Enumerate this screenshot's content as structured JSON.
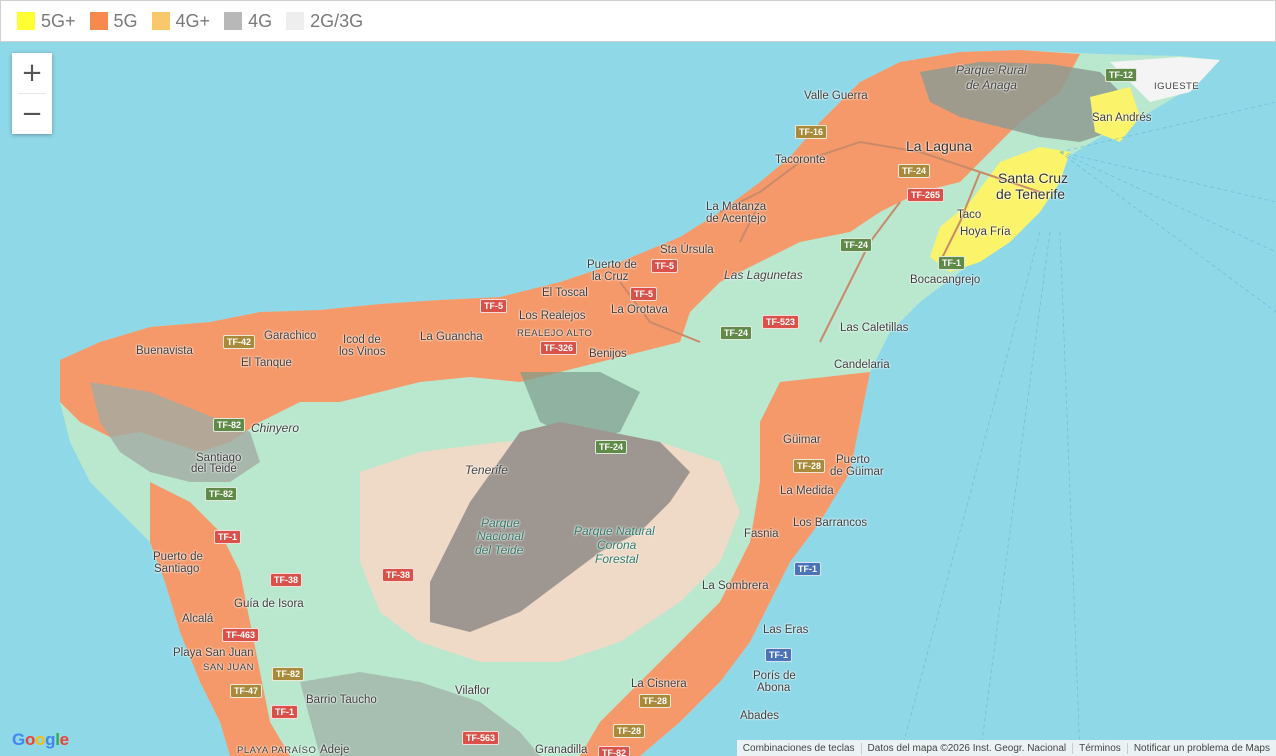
{
  "legend": {
    "items": [
      {
        "label": "5G+",
        "color": "#ffff33"
      },
      {
        "label": "5G",
        "color": "#f58a4e"
      },
      {
        "label": "4G+",
        "color": "#f8c86a"
      },
      {
        "label": "4G",
        "color": "#b8b8b8"
      },
      {
        "label": "2G/3G",
        "color": "#eeeeee"
      }
    ]
  },
  "zoom": {
    "in": "+",
    "out": "−"
  },
  "places": {
    "parque_rural": "Parque Rural",
    "anaga": "de Anaga",
    "igueste": "IGUESTE",
    "valle_guerra": "Valle Guerra",
    "san_andres": "San Andrés",
    "la_laguna": "La Laguna",
    "tacoronte": "Tacoronte",
    "santa_cruz_1": "Santa Cruz",
    "santa_cruz_2": "de Tenerife",
    "la_matanza_1": "La Matanza",
    "la_matanza_2": "de Acentejo",
    "taco": "Taco",
    "hoya_fria": "Hoya Fría",
    "sta_ursula": "Sta Úrsula",
    "puerto_cruz_1": "Puerto de",
    "puerto_cruz_2": "la Cruz",
    "las_lagunetas": "Las Lagunetas",
    "bocacangrejo": "Bocacangrejo",
    "el_toscal": "El Toscal",
    "los_realejos": "Los Realejos",
    "la_orotava": "La Orotava",
    "realejo_alto": "REALEJO ALTO",
    "garachico": "Garachico",
    "icod_1": "Icod de",
    "icod_2": "los Vinos",
    "la_guancha": "La Guancha",
    "las_caletillas": "Las Caletillas",
    "buenavista": "Buenavista",
    "el_tanque": "El Tanque",
    "benijos": "Benijos",
    "candelaria": "Candelaria",
    "chinyero": "Chinyero",
    "guimar": "Güimar",
    "santiago_1": "Santiago",
    "santiago_2": "del Teide",
    "tenerife": "Tenerife",
    "puerto_guimar_1": "Puerto",
    "puerto_guimar_2": "de Güimar",
    "la_medida": "La Medida",
    "pn_teide_1": "Parque",
    "pn_teide_2": "Nacional",
    "pn_teide_3": "del Teide",
    "pn_corona_1": "Parque Natural",
    "pn_corona_2": "Corona",
    "pn_corona_3": "Forestal",
    "los_barrancos": "Los Barrancos",
    "puerto_santiago_1": "Puerto de",
    "puerto_santiago_2": "Santiago",
    "fasnia": "Fasnia",
    "la_sombrera": "La Sombrera",
    "guia_isora": "Guía de Isora",
    "alcala": "Alcalá",
    "las_eras": "Las Eras",
    "playa_san_juan": "Playa San Juan",
    "san_juan": "SAN JUAN",
    "la_cisnera": "La Cisnera",
    "poris_1": "Porís de",
    "poris_2": "Abona",
    "barrio_taucho": "Barrio Taucho",
    "vilaflor": "Vilaflor",
    "abades": "Abades",
    "playa_paraiso": "PLAYA PARAÍSO",
    "adeje": "Adeje",
    "granadilla": "Granadilla"
  },
  "roads": {
    "tf12": "TF-12",
    "tf16": "TF-16",
    "tf24a": "TF-24",
    "tf265": "TF-265",
    "tf24b": "TF-24",
    "tf1a": "TF-1",
    "tf5a": "TF-5",
    "tf5b": "TF-5",
    "tf5c": "TF-5",
    "tf523": "TF-523",
    "tf24c": "TF-24",
    "tf42": "TF-42",
    "tf326": "TF-326",
    "tf82a": "TF-82",
    "tf24d": "TF-24",
    "tf28a": "TF-28",
    "tf82b": "TF-82",
    "tf1b": "TF-1",
    "tf38a": "TF-38",
    "tf38b": "TF-38",
    "tf1c": "TF-1",
    "tf463": "TF-463",
    "tf1d": "TF-1",
    "tf82c": "TF-82",
    "tf47": "TF-47",
    "tf28b": "TF-28",
    "tf1e": "TF-1",
    "tf28c": "TF-28",
    "tf563": "TF-563",
    "tf82d": "TF-82"
  },
  "attribution": {
    "shortcuts": "Combinaciones de teclas",
    "data": "Datos del mapa ©2026 Inst. Geogr. Nacional",
    "terms": "Términos",
    "report": "Notificar un problema de Maps"
  },
  "logo": {
    "g1": "G",
    "g2": "o",
    "g3": "o",
    "g4": "g",
    "g5": "l",
    "g6": "e"
  }
}
